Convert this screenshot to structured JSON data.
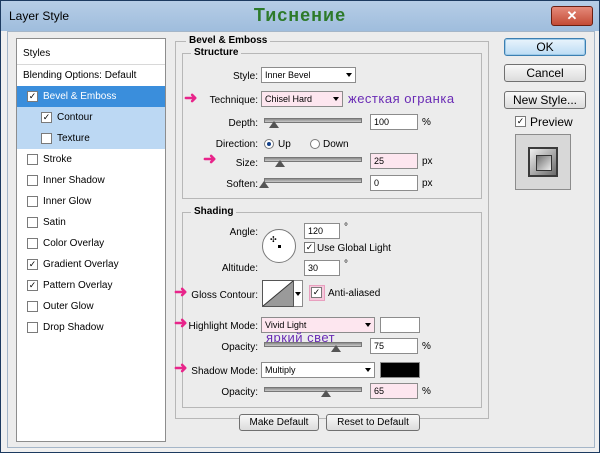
{
  "window": {
    "title": "Layer Style",
    "overlay_title": "Тиснение",
    "close_glyph": "✕"
  },
  "sidebar": {
    "items": [
      {
        "label": "Styles",
        "checkbox": false,
        "checked": false,
        "state": "header"
      },
      {
        "label": "Blending Options: Default",
        "checkbox": false,
        "checked": false,
        "state": "normal"
      },
      {
        "label": "Bevel & Emboss",
        "checkbox": true,
        "checked": true,
        "state": "selected"
      },
      {
        "label": "Contour",
        "checkbox": true,
        "checked": true,
        "state": "sub"
      },
      {
        "label": "Texture",
        "checkbox": true,
        "checked": false,
        "state": "sub"
      },
      {
        "label": "Stroke",
        "checkbox": true,
        "checked": false,
        "state": "normal"
      },
      {
        "label": "Inner Shadow",
        "checkbox": true,
        "checked": false,
        "state": "normal"
      },
      {
        "label": "Inner Glow",
        "checkbox": true,
        "checked": false,
        "state": "normal"
      },
      {
        "label": "Satin",
        "checkbox": true,
        "checked": false,
        "state": "normal"
      },
      {
        "label": "Color Overlay",
        "checkbox": true,
        "checked": false,
        "state": "normal"
      },
      {
        "label": "Gradient Overlay",
        "checkbox": true,
        "checked": true,
        "state": "normal"
      },
      {
        "label": "Pattern Overlay",
        "checkbox": true,
        "checked": true,
        "state": "normal"
      },
      {
        "label": "Outer Glow",
        "checkbox": true,
        "checked": false,
        "state": "normal"
      },
      {
        "label": "Drop Shadow",
        "checkbox": true,
        "checked": false,
        "state": "normal"
      }
    ]
  },
  "bevel": {
    "group_title": "Bevel & Emboss",
    "structure_title": "Structure",
    "style_label": "Style:",
    "style_value": "Inner Bevel",
    "technique_label": "Technique:",
    "technique_value": "Chisel Hard",
    "technique_note": "жесткая огранка",
    "depth_label": "Depth:",
    "depth_value": "100",
    "depth_unit": "%",
    "depth_level": 0.1,
    "direction_label": "Direction:",
    "direction_up": "Up",
    "direction_down": "Down",
    "direction_selected": "Up",
    "size_label": "Size:",
    "size_value": "25",
    "size_unit": "px",
    "size_level": 0.17,
    "soften_label": "Soften:",
    "soften_value": "0",
    "soften_unit": "px",
    "soften_level": 0.0
  },
  "shading": {
    "title": "Shading",
    "angle_label": "Angle:",
    "angle_value": "120",
    "angle_unit": "°",
    "global_light_label": "Use Global Light",
    "global_light_checked": true,
    "altitude_label": "Altitude:",
    "altitude_value": "30",
    "altitude_unit": "°",
    "gloss_label": "Gloss Contour:",
    "anti_aliased_label": "Anti-aliased",
    "anti_aliased_checked": true,
    "highlight_label": "Highlight Mode:",
    "highlight_value": "Vivid Light",
    "highlight_note": "яркий свет",
    "highlight_color": "#ffffff",
    "h_opacity_label": "Opacity:",
    "h_opacity_value": "75",
    "h_opacity_unit": "%",
    "h_opacity_level": 0.75,
    "shadow_label": "Shadow Mode:",
    "shadow_value": "Multiply",
    "shadow_color": "#000000",
    "s_opacity_label": "Opacity:",
    "s_opacity_value": "65",
    "s_opacity_unit": "%",
    "s_opacity_level": 0.65
  },
  "footer": {
    "make_default": "Make Default",
    "reset_default": "Reset to Default"
  },
  "buttons": {
    "ok": "OK",
    "cancel": "Cancel",
    "new_style": "New Style...",
    "preview_label": "Preview",
    "preview_checked": true
  },
  "colors": {
    "accent_arrow": "#e8248a",
    "annotation": "#6a2bb5",
    "overlay_title": "#2d7a2a",
    "selected": "#3a8edc"
  }
}
